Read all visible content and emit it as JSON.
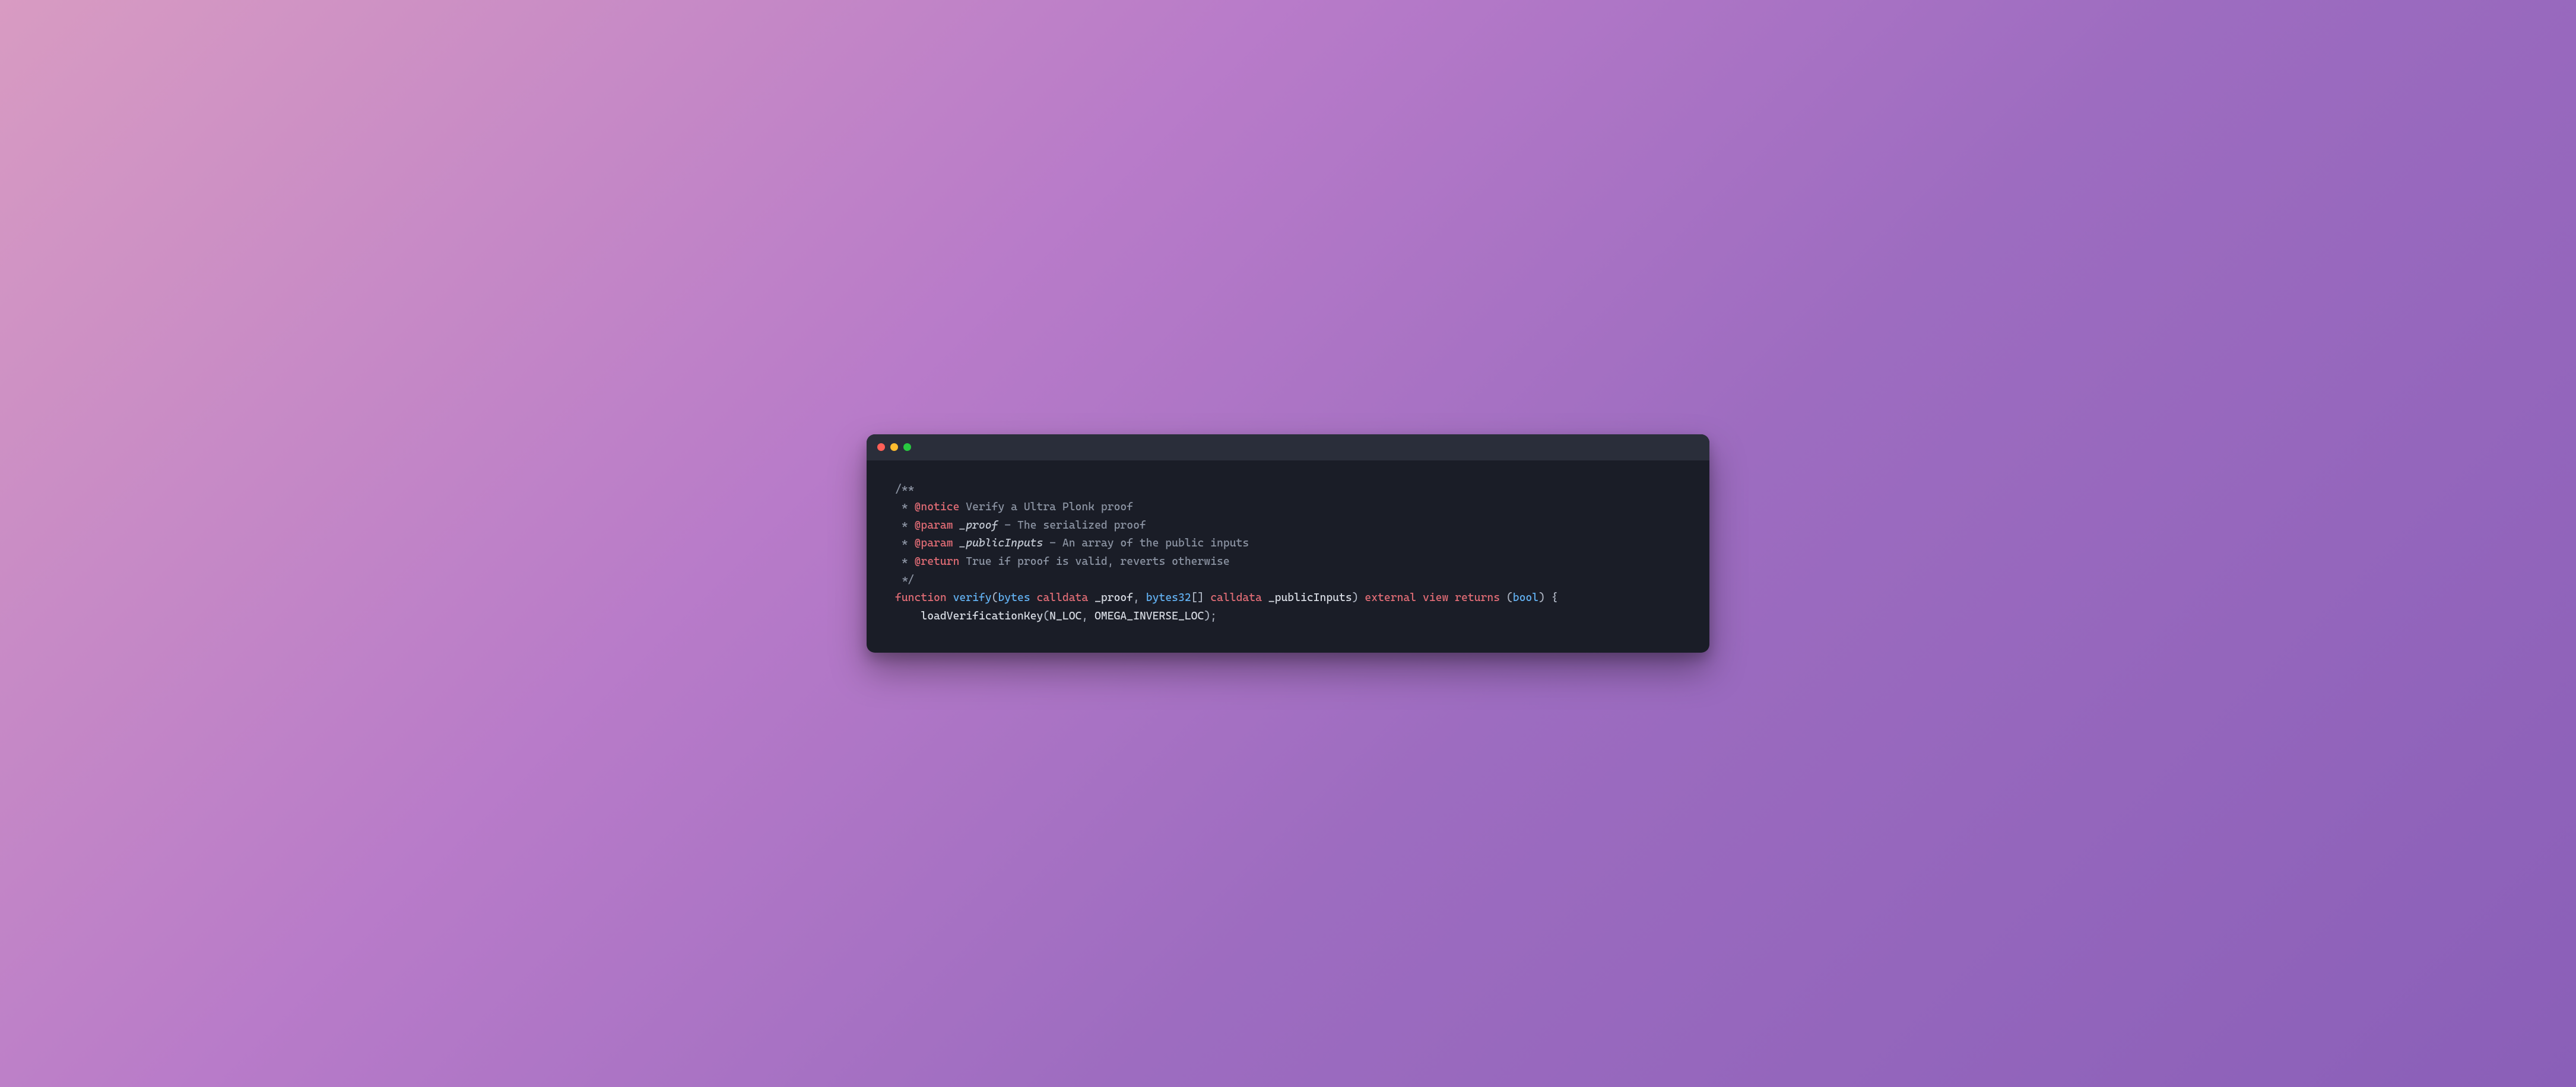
{
  "code": {
    "line1": "/**",
    "line2_pre": " * ",
    "line2_tag": "@notice",
    "line2_rest": " Verify a Ultra Plonk proof",
    "line3_pre": " * ",
    "line3_tag": "@param",
    "line3_name": " _proof",
    "line3_rest": " - The serialized proof",
    "line4_pre": " * ",
    "line4_tag": "@param",
    "line4_name": " _publicInputs",
    "line4_rest": " - An array of the public inputs",
    "line5_pre": " * ",
    "line5_tag": "@return",
    "line5_rest": " True if proof is valid, reverts otherwise",
    "line6": " */",
    "line7_kw_function": "function",
    "line7_sp1": " ",
    "line7_name": "verify",
    "line7_lparen": "(",
    "line7_type1": "bytes",
    "line7_sp2": " ",
    "line7_mod1": "calldata",
    "line7_sp3": " ",
    "line7_arg1": "_proof",
    "line7_comma": ", ",
    "line7_type2": "bytes32",
    "line7_brackets": "[]",
    "line7_sp4": " ",
    "line7_mod2": "calldata",
    "line7_sp5": " ",
    "line7_arg2": "_publicInputs",
    "line7_rparen": ") ",
    "line7_external": "external",
    "line7_sp6": " ",
    "line7_view": "view",
    "line7_sp7": " ",
    "line7_returns": "returns",
    "line7_sp8": " (",
    "line7_bool": "bool",
    "line7_end": ") {",
    "line8_indent": "    ",
    "line8_call": "loadVerificationKey",
    "line8_lparen": "(",
    "line8_arg1": "N_LOC",
    "line8_comma": ", ",
    "line8_arg2": "OMEGA_INVERSE_LOC",
    "line8_end": ");"
  }
}
